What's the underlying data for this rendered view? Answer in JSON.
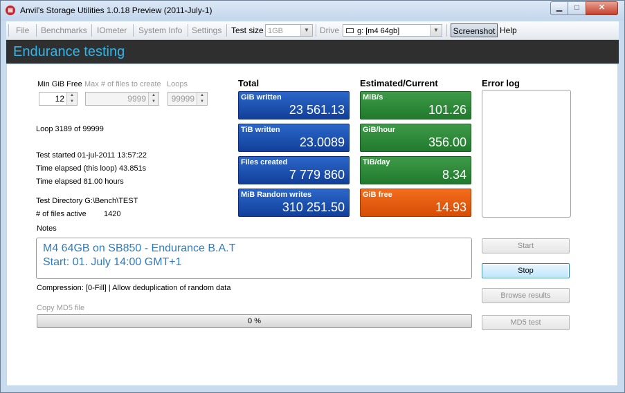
{
  "window": {
    "title": "Anvil's Storage Utilities 1.0.18 Preview (2011-July-1)"
  },
  "menu": {
    "file": "File",
    "benchmarks": "Benchmarks",
    "iometer": "IOmeter",
    "system_info": "System Info",
    "settings": "Settings",
    "test_size_label": "Test size",
    "test_size_value": "1GB",
    "drive_label": "Drive",
    "drive_value": "g: [m4 64gb]",
    "screenshot": "Screenshot",
    "help": "Help"
  },
  "header": {
    "title": "Endurance testing"
  },
  "params": {
    "min_free_label": "Min GiB Free",
    "min_free_value": "12",
    "max_files_label": "Max # of files to create",
    "max_files_value": "9999",
    "loops_label": "Loops",
    "loops_value": "99999"
  },
  "status": {
    "loop": "Loop 3189 of 99999",
    "test_started": "Test started 01-jul-2011 13:57:22",
    "elapsed_loop": "Time elapsed (this loop) 43.851s",
    "elapsed_total": "Time elapsed 81.00 hours",
    "test_dir": "Test Directory G:\\Bench\\TEST",
    "files_active_label": "# of files active",
    "files_active_value": "1420"
  },
  "total": {
    "heading": "Total",
    "tiles": [
      {
        "label": "GiB written",
        "value": "23 561.13"
      },
      {
        "label": "TiB written",
        "value": "23.0089"
      },
      {
        "label": "Files created",
        "value": "7 779 860"
      },
      {
        "label": "MiB Random writes",
        "value": "310 251.50"
      }
    ]
  },
  "current": {
    "heading": "Estimated/Current",
    "tiles": [
      {
        "label": "MiB/s",
        "value": "101.26"
      },
      {
        "label": "GiB/hour",
        "value": "356.00"
      },
      {
        "label": "TiB/day",
        "value": "8.34"
      },
      {
        "label": "GiB free",
        "value": "14.93"
      }
    ]
  },
  "error_log": {
    "heading": "Error log"
  },
  "notes": {
    "label": "Notes",
    "line1": "M4 64GB on SB850 - Endurance B.A.T",
    "line2": "Start: 01. July 14:00 GMT+1"
  },
  "compression": "Compression: [0-Fill] | Allow deduplication of random data",
  "md5": {
    "label": "Copy MD5 file",
    "progress_text": "0 %",
    "progress_fraction": 0.0
  },
  "buttons": {
    "start": "Start",
    "stop": "Stop",
    "browse": "Browse results",
    "md5_test": "MD5 test"
  },
  "colors": {
    "accent": "#33b5ea",
    "tile_blue": "#1f55b5",
    "tile_green": "#2e8a3a",
    "tile_orange": "#e85a10"
  }
}
